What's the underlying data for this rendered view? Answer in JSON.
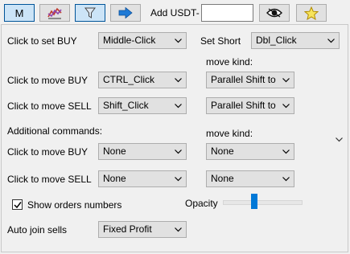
{
  "toolbar": {
    "m_label": "M",
    "add_usdt_label": "Add USDT-",
    "usdt_value": ""
  },
  "form": {
    "set_buy_label": "Click to set BUY",
    "set_buy_value": "Middle-Click",
    "set_short_label": "Set Short",
    "set_short_value": "Dbl_Click",
    "move_kind_label_1": "move kind:",
    "move_buy_label": "Click to move BUY",
    "move_buy_value": "CTRL_Click",
    "move_buy_kind": "Parallel Shift to",
    "move_sell_label": "Click to move SELL",
    "move_sell_value": "Shift_Click",
    "move_sell_kind": "Parallel Shift to",
    "additional_label": "Additional commands:",
    "move_kind_label_2": "move kind:",
    "add_move_buy_label": "Click to move BUY",
    "add_move_buy_value": "None",
    "add_move_buy_kind": "None",
    "add_move_sell_label": "Click to move SELL",
    "add_move_sell_value": "None",
    "add_move_sell_kind": "None",
    "show_orders_label": "Show orders numbers",
    "show_orders_checked": true,
    "opacity_label": "Opacity",
    "opacity_level": 0.38,
    "auto_join_label": "Auto join sells",
    "auto_join_value": "Fixed Profit"
  },
  "icons": [
    "chart-icon",
    "filter-icon",
    "arrow-right-icon",
    "eye-icon",
    "star-icon",
    "chevron-down-icon"
  ],
  "colors": {
    "accent": "#0078d7",
    "active_button": "#cce4f7",
    "button": "#e1e1e1",
    "background": "#f0f0f0"
  }
}
